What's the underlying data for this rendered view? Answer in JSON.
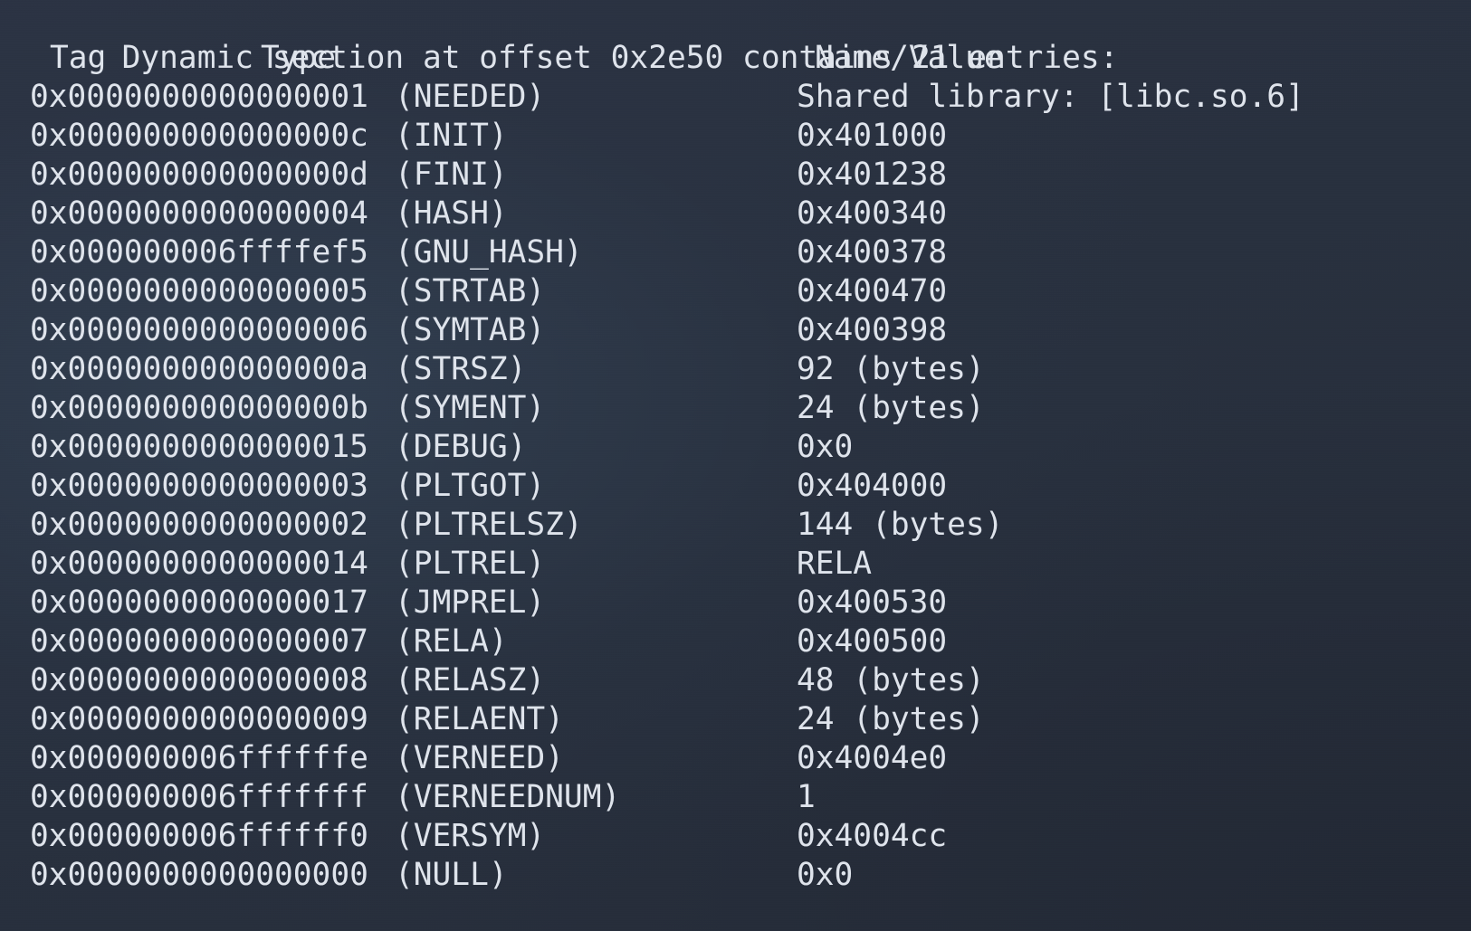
{
  "terminal": {
    "background_color": "#272e3c",
    "text_color": "#dfe4ec",
    "title_line": "Dynamic section at offset 0x2e50 contains 21 entries:"
  },
  "columns": {
    "tag_header": "Tag",
    "type_header": "Type",
    "name_value_header": "Name/Value"
  },
  "entries": [
    {
      "tag": "0x0000000000000001",
      "type": "(NEEDED)",
      "value": "Shared library: [libc.so.6]"
    },
    {
      "tag": "0x000000000000000c",
      "type": "(INIT)",
      "value": "0x401000"
    },
    {
      "tag": "0x000000000000000d",
      "type": "(FINI)",
      "value": "0x401238"
    },
    {
      "tag": "0x0000000000000004",
      "type": "(HASH)",
      "value": "0x400340"
    },
    {
      "tag": "0x000000006ffffef5",
      "type": "(GNU_HASH)",
      "value": "0x400378"
    },
    {
      "tag": "0x0000000000000005",
      "type": "(STRTAB)",
      "value": "0x400470"
    },
    {
      "tag": "0x0000000000000006",
      "type": "(SYMTAB)",
      "value": "0x400398"
    },
    {
      "tag": "0x000000000000000a",
      "type": "(STRSZ)",
      "value": "92 (bytes)"
    },
    {
      "tag": "0x000000000000000b",
      "type": "(SYMENT)",
      "value": "24 (bytes)"
    },
    {
      "tag": "0x0000000000000015",
      "type": "(DEBUG)",
      "value": "0x0"
    },
    {
      "tag": "0x0000000000000003",
      "type": "(PLTGOT)",
      "value": "0x404000"
    },
    {
      "tag": "0x0000000000000002",
      "type": "(PLTRELSZ)",
      "value": "144 (bytes)"
    },
    {
      "tag": "0x0000000000000014",
      "type": "(PLTREL)",
      "value": "RELA"
    },
    {
      "tag": "0x0000000000000017",
      "type": "(JMPREL)",
      "value": "0x400530"
    },
    {
      "tag": "0x0000000000000007",
      "type": "(RELA)",
      "value": "0x400500"
    },
    {
      "tag": "0x0000000000000008",
      "type": "(RELASZ)",
      "value": "48 (bytes)"
    },
    {
      "tag": "0x0000000000000009",
      "type": "(RELAENT)",
      "value": "24 (bytes)"
    },
    {
      "tag": "0x000000006ffffffe",
      "type": "(VERNEED)",
      "value": "0x4004e0"
    },
    {
      "tag": "0x000000006fffffff",
      "type": "(VERNEEDNUM)",
      "value": "1"
    },
    {
      "tag": "0x000000006ffffff0",
      "type": "(VERSYM)",
      "value": "0x4004cc"
    },
    {
      "tag": "0x0000000000000000",
      "type": "(NULL)",
      "value": "0x0"
    }
  ]
}
